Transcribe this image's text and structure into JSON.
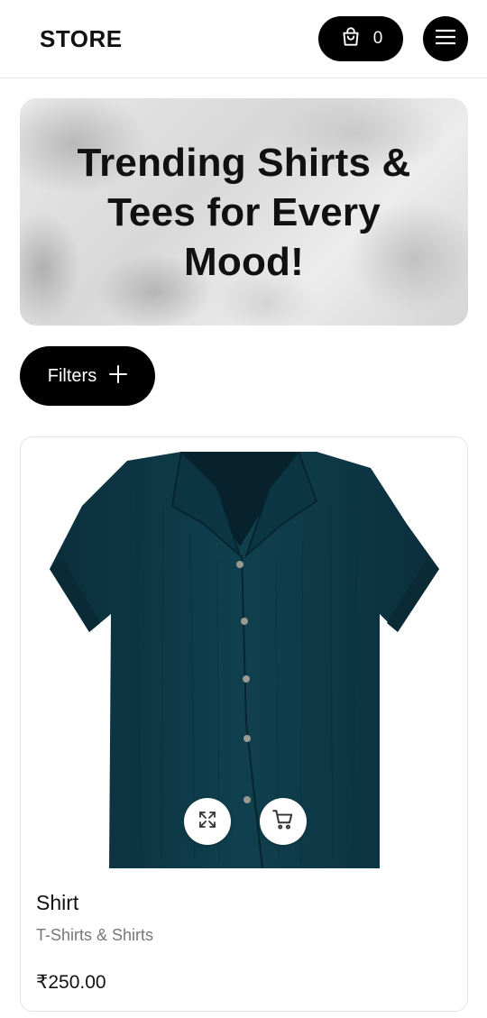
{
  "header": {
    "logo": "STORE",
    "cart_count": "0",
    "cart_icon": "shopping-bag-icon",
    "menu_icon": "hamburger-menu-icon"
  },
  "hero": {
    "title": "Trending Shirts & Tees for Every Mood!"
  },
  "filters": {
    "label": "Filters",
    "icon": "plus-icon"
  },
  "product": {
    "name": "Shirt",
    "category": "T-Shirts & Shirts",
    "price": "₹250.00",
    "color": "#0f3a4a",
    "actions": [
      "expand-icon",
      "cart-icon"
    ]
  }
}
